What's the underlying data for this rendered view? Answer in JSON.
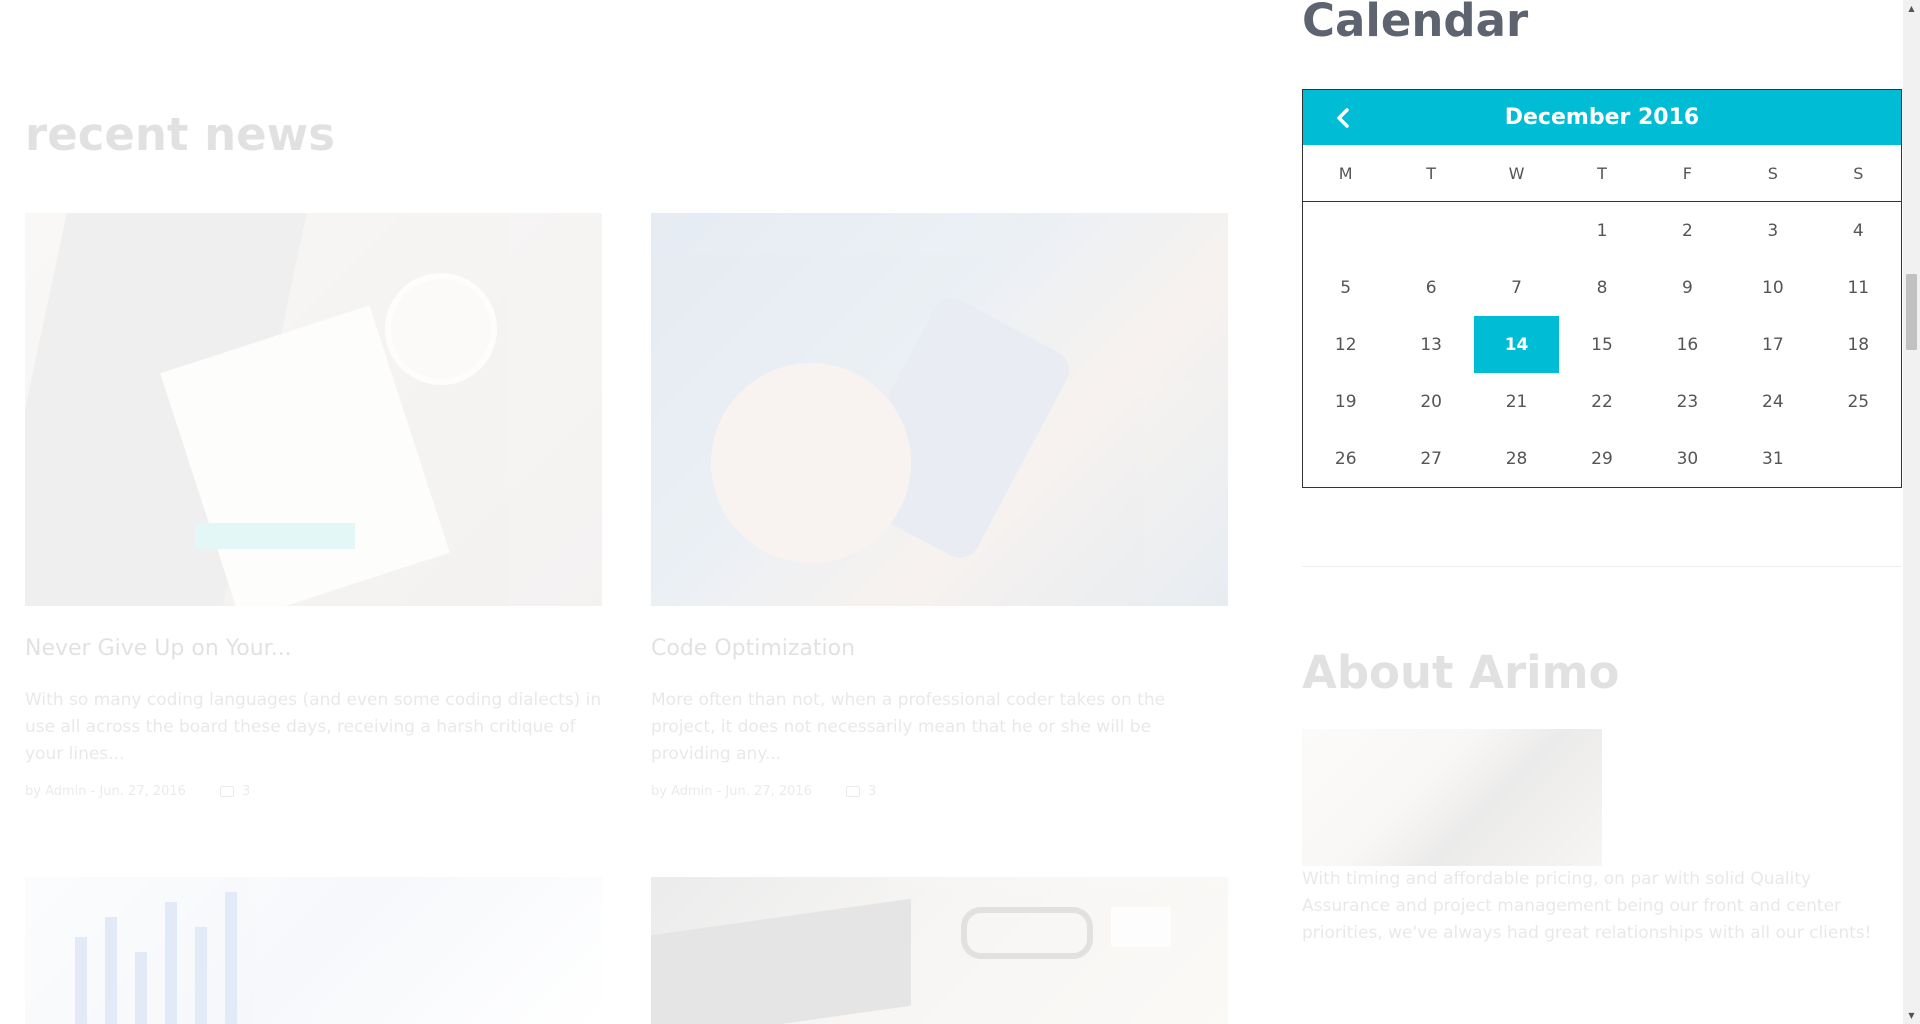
{
  "news": {
    "title": "recent news",
    "prev_arrow": "‹",
    "next_arrow": "›",
    "posts": [
      {
        "title": "Never Give Up on Your...",
        "excerpt": "With so many coding languages (and even some coding dialects) in use all across the board these days, receiving a harsh critique of your lines...",
        "meta": "by Admin - Jun. 27, 2016",
        "comments": "3"
      },
      {
        "title": "Code Optimization",
        "excerpt": "More often than not, when a professional coder takes on the project, it does not necessarily mean that he or she will be providing any...",
        "meta": "by Admin - Jun. 27, 2016",
        "comments": "3"
      }
    ]
  },
  "sidebar": {
    "calendar_heading": "Calendar",
    "calendar": {
      "month_label": "December 2016",
      "weekdays": [
        "M",
        "T",
        "W",
        "T",
        "F",
        "S",
        "S"
      ],
      "weeks": [
        [
          "",
          "",
          "",
          "1",
          "2",
          "3",
          "4"
        ],
        [
          "5",
          "6",
          "7",
          "8",
          "9",
          "10",
          "11"
        ],
        [
          "12",
          "13",
          "14",
          "15",
          "16",
          "17",
          "18"
        ],
        [
          "19",
          "20",
          "21",
          "22",
          "23",
          "24",
          "25"
        ],
        [
          "26",
          "27",
          "28",
          "29",
          "30",
          "31",
          ""
        ]
      ],
      "today": "14",
      "accent_color": "#00bcd4"
    },
    "about": {
      "title": "About Arimo",
      "text": "With timing and affordable pricing, on par with solid Quality Assurance and project management being our front and center priorities, we've always had great relationships with all our clients!"
    }
  }
}
